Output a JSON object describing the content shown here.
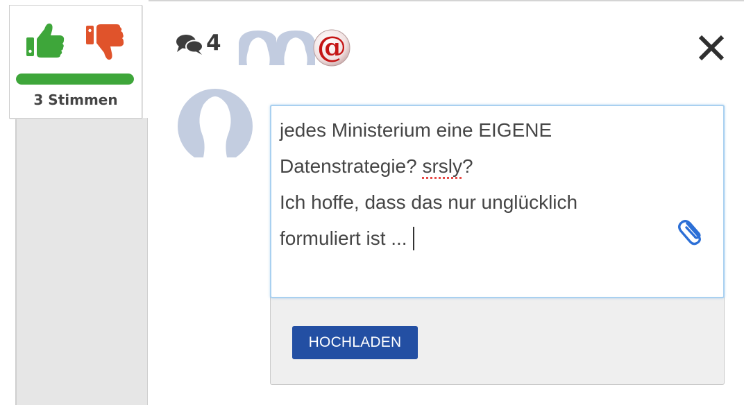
{
  "vote": {
    "count_label": "3 Stimmen",
    "approval_fraction": 1.0,
    "colors": {
      "up": "#3ea63a",
      "down": "#e0532b",
      "bar": "#3ea63a"
    }
  },
  "header": {
    "comment_count": "4",
    "participant_avatars": [
      "avatar-placeholder",
      "avatar-placeholder",
      "at-sign-avatar"
    ]
  },
  "composer": {
    "lines": [
      "jedes Ministerium eine EIGENE",
      "Datenstrategie? ",
      "srsly",
      "?",
      "Ich hoffe, dass das nur unglücklich",
      "formuliert ist ..."
    ],
    "upload_label": "HOCHLADEN"
  },
  "icons": {
    "close": "close-icon",
    "attach": "paperclip-icon",
    "comments": "comments-icon",
    "thumb_up": "thumb-up-icon",
    "thumb_down": "thumb-down-icon"
  },
  "colors": {
    "accent": "#234fa3",
    "focus_border": "#a9d0f0",
    "paperclip": "#2c6fd6"
  }
}
